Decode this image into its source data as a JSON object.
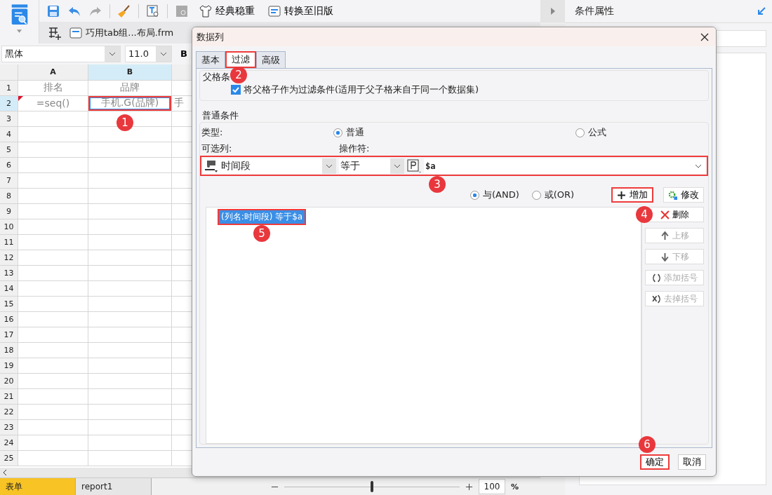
{
  "toolbar": {
    "theme_button": "经典稳重",
    "legacy_button": "转换至旧版"
  },
  "file_tab": {
    "label": "巧用tab组...布局.frm"
  },
  "format_bar": {
    "font": "黑体",
    "size": "11.0",
    "bold": "B"
  },
  "sheet": {
    "columns": [
      {
        "label": "A",
        "selected": false
      },
      {
        "label": "B",
        "selected": true
      }
    ],
    "rows": [
      {
        "number": "1",
        "selected": false,
        "cells": [
          {
            "text": "排名",
            "flagged": false
          },
          {
            "text": "品牌",
            "flagged": false
          }
        ]
      },
      {
        "number": "2",
        "selected": true,
        "cells": [
          {
            "text": "=seq()",
            "flagged": true
          },
          {
            "text": "手机.G(品牌)",
            "flagged": false
          },
          {
            "text": "手",
            "flagged": false
          }
        ]
      },
      {
        "number": "3",
        "selected": false
      },
      {
        "number": "4",
        "selected": false
      },
      {
        "number": "5",
        "selected": false
      },
      {
        "number": "6",
        "selected": false
      },
      {
        "number": "7",
        "selected": false
      },
      {
        "number": "8",
        "selected": false
      },
      {
        "number": "9",
        "selected": false
      },
      {
        "number": "10",
        "selected": false
      },
      {
        "number": "11",
        "selected": false
      },
      {
        "number": "12",
        "selected": false
      },
      {
        "number": "13",
        "selected": false
      },
      {
        "number": "14",
        "selected": false
      },
      {
        "number": "15",
        "selected": false
      },
      {
        "number": "16",
        "selected": false
      },
      {
        "number": "17",
        "selected": false
      },
      {
        "number": "18",
        "selected": false
      },
      {
        "number": "19",
        "selected": false
      },
      {
        "number": "20",
        "selected": false
      },
      {
        "number": "21",
        "selected": false
      },
      {
        "number": "22",
        "selected": false
      },
      {
        "number": "23",
        "selected": false
      },
      {
        "number": "24",
        "selected": false
      },
      {
        "number": "25",
        "selected": false
      }
    ]
  },
  "sheet_tabs": [
    {
      "label": "表单",
      "selected": true
    },
    {
      "label": "report1",
      "selected": false
    }
  ],
  "zoom": {
    "value": "100",
    "unit": "%",
    "level": 0.5
  },
  "side_panel": {
    "title": "条件属性"
  },
  "dialog": {
    "title": "数据列",
    "tabs": [
      {
        "label": "基本",
        "selected": false
      },
      {
        "label": "过滤",
        "selected": true
      },
      {
        "label": "高级",
        "selected": false
      }
    ],
    "parent_group": {
      "title": "父格条",
      "checkbox_label": "将父格子作为过滤条件(适用于父子格来自于同一个数据集)",
      "checked": true
    },
    "normal_group": {
      "title": "普通条件",
      "type_label": "类型:",
      "type_options": [
        {
          "label": "普通",
          "selected": true
        },
        {
          "label": "公式",
          "selected": false
        }
      ],
      "column_label": "可选列:",
      "operator_label": "操作符:",
      "column_select": "时间段",
      "operator_select": "等于",
      "value": "$a",
      "logic_options": [
        {
          "label": "与(AND)",
          "selected": true
        },
        {
          "label": "或(OR)",
          "selected": false
        }
      ],
      "top_buttons": [
        {
          "label": "增加",
          "kind": "add"
        },
        {
          "label": "修改",
          "kind": "edit"
        }
      ],
      "conditions": [
        {
          "text": "(列名:时间段) 等于$a",
          "selected": true
        }
      ],
      "side_buttons": [
        {
          "label": "删除",
          "kind": "delete",
          "disabled": false
        },
        {
          "label": "上移",
          "kind": "up",
          "disabled": true
        },
        {
          "label": "下移",
          "kind": "down",
          "disabled": true
        },
        {
          "label": "添加括号",
          "kind": "paren-add",
          "disabled": true
        },
        {
          "label": "去掉括号",
          "kind": "paren-remove",
          "disabled": true
        }
      ]
    },
    "footer_buttons": [
      "确定",
      "取消"
    ]
  },
  "callouts": [
    "1",
    "2",
    "3",
    "4",
    "5",
    "6"
  ]
}
